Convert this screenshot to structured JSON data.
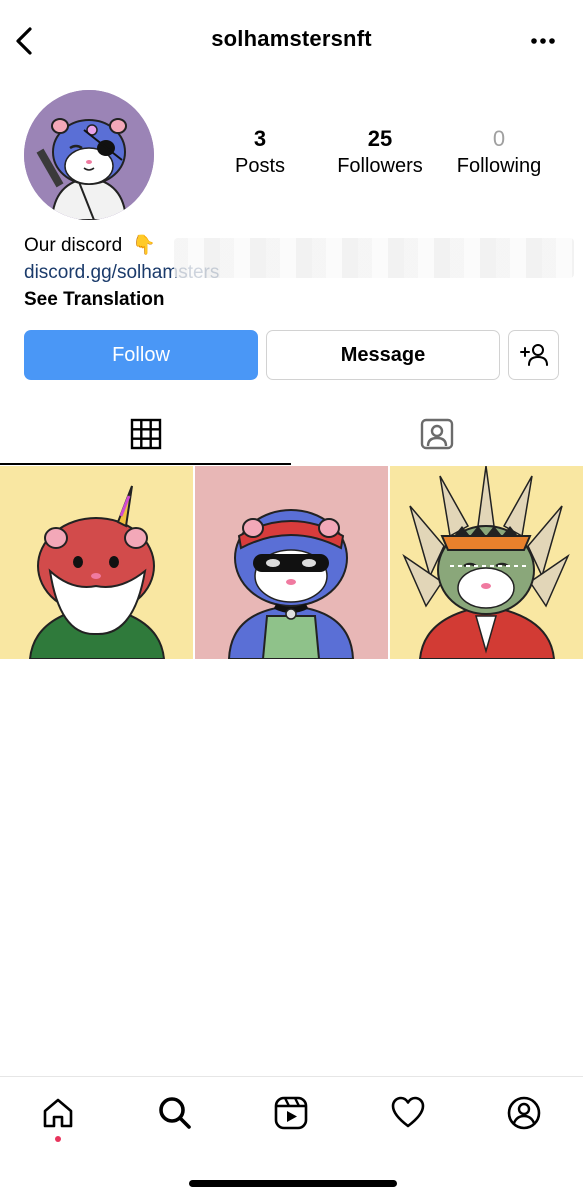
{
  "header": {
    "username": "solhamstersnft"
  },
  "icons": {
    "back": "chevron-left-icon",
    "more": "more-horizontal-icon",
    "add_person": "add-person-icon",
    "grid_tab": "grid-icon",
    "tagged_tab": "tagged-person-icon",
    "nav": [
      "home-icon",
      "search-icon",
      "reels-icon",
      "heart-icon",
      "profile-icon"
    ]
  },
  "stats": {
    "posts": {
      "value": "3",
      "label": "Posts"
    },
    "followers": {
      "value": "25",
      "label": "Followers"
    },
    "following": {
      "value": "0",
      "label": "Following"
    }
  },
  "bio": {
    "line1": "Our discord",
    "emoji": "👇",
    "link": "discord.gg/solhamsters",
    "see_translation": "See Translation"
  },
  "buttons": {
    "follow": "Follow",
    "message": "Message"
  },
  "posts": [
    {
      "description": "hamster-unicorn-beard",
      "bg": "#f9e7a2"
    },
    {
      "description": "hamster-bandit-mask",
      "bg": "#e8b7b6"
    },
    {
      "description": "hamster-feather-headdress",
      "bg": "#f9e7a2"
    }
  ],
  "colors": {
    "accent": "#4a97f6",
    "link": "#1b3b6b",
    "notification": "#e8345c"
  }
}
